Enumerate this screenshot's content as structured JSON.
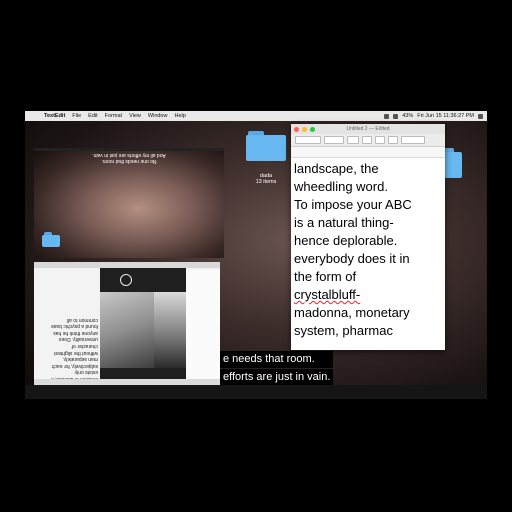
{
  "menubar": {
    "app": "TextEdit",
    "items": [
      "File",
      "Edit",
      "Format",
      "View",
      "Window",
      "Help"
    ],
    "datetime": "Fri Jun 15 11:36:27 PM",
    "battery": "43%"
  },
  "video_top": {
    "caption_line1": "No one needs that room.",
    "caption_line2": "And all my efforts are just in vain."
  },
  "desktop": {
    "folder_label": "dada",
    "folder_sublabel": "13 items"
  },
  "mirror_text": {
    "lines": [
      "criticism is useless, it",
      "exists only",
      "subjectively, for each",
      "man separately,",
      "without the slightest",
      "character of",
      "universality. Does",
      "anyone think he has",
      "found a psychic base",
      "common to all"
    ]
  },
  "editor": {
    "title": "Untitled 2 — Edited",
    "lines": [
      "landscape, the",
      "wheedling word.",
      "To impose your ABC",
      "is a natural thing-",
      "hence deplorable.",
      "everybody does it in",
      "the form of",
      "crystalbluff-",
      "madonna, monetary",
      "system, pharmac"
    ]
  },
  "subtitles": {
    "line1": "e needs that room.",
    "line2": "efforts are just in vain."
  },
  "colors": {
    "folder": "#67b7f0",
    "close": "#fc5f57",
    "minimize": "#fdbc2e",
    "zoom": "#28c840"
  }
}
